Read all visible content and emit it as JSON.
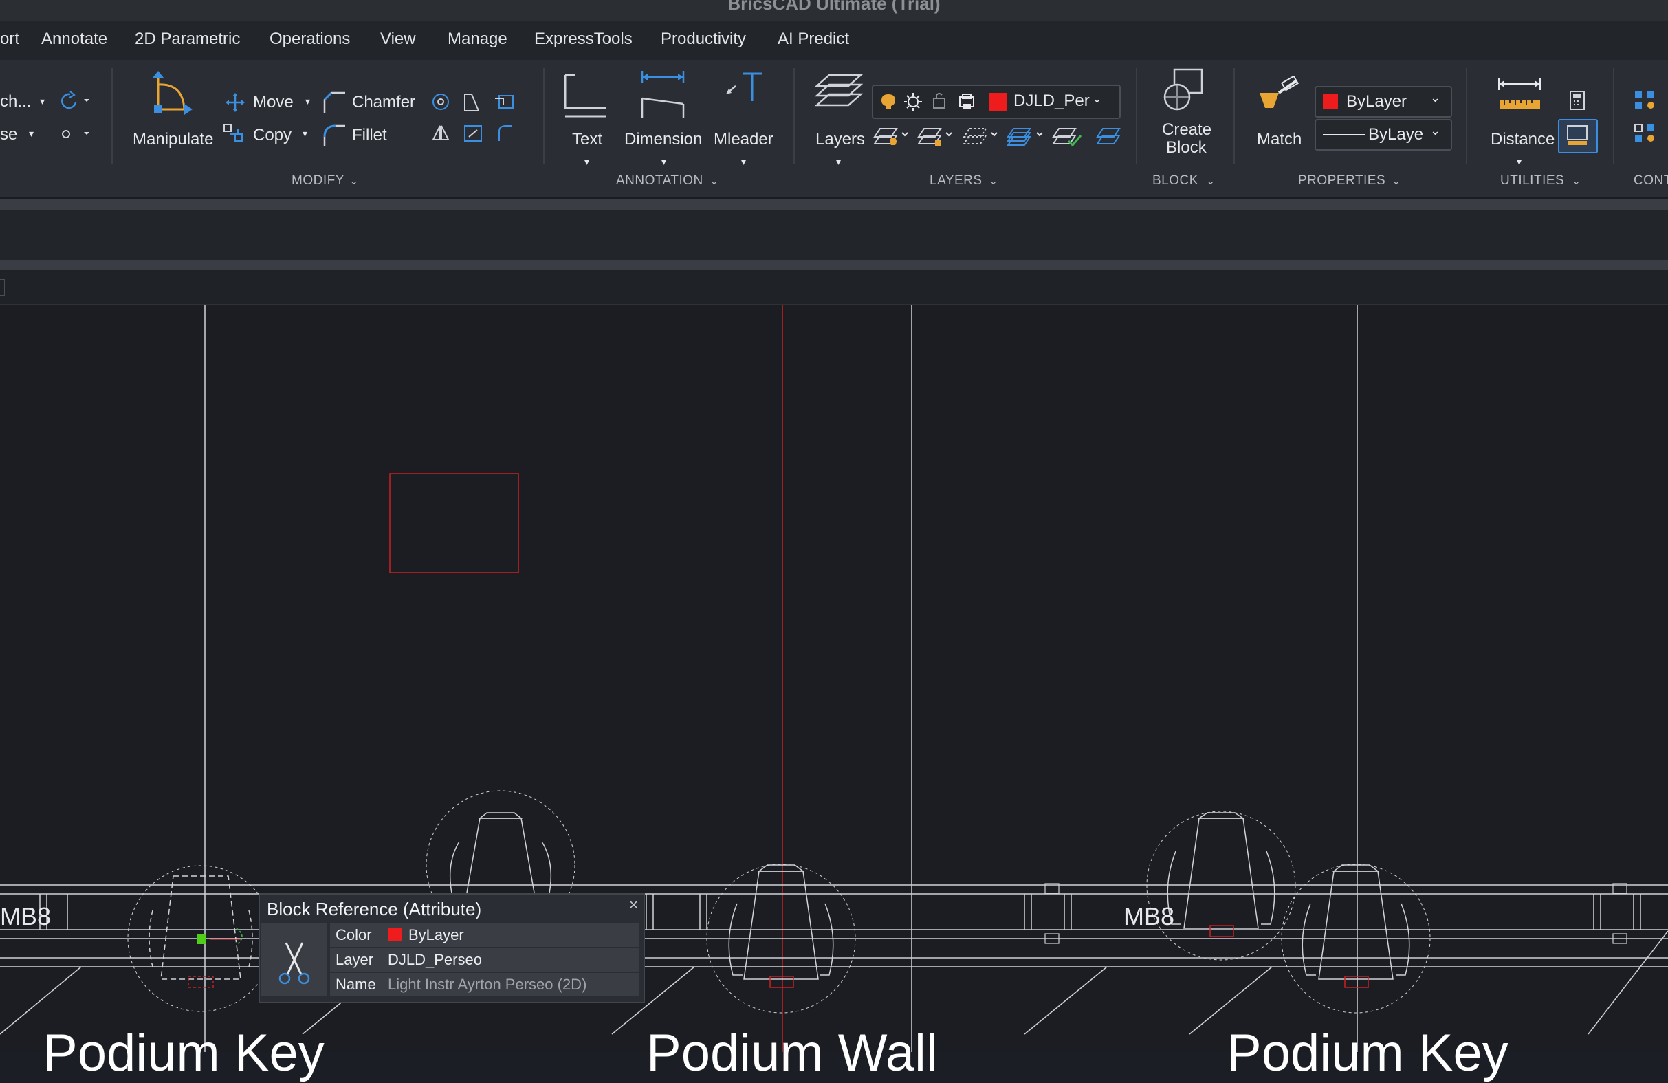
{
  "app": {
    "title": "BricsCAD Ultimate (Trial)"
  },
  "menu": [
    "ort",
    "Annotate",
    "2D Parametric",
    "Operations",
    "View",
    "Manage",
    "ExpressTools",
    "Productivity",
    "AI Predict"
  ],
  "ribbon": {
    "left_cut_1": "ch...",
    "left_cut_2": "se",
    "modify": {
      "manipulate": "Manipulate",
      "move": "Move",
      "copy": "Copy",
      "chamfer": "Chamfer",
      "fillet": "Fillet",
      "panel_label": "MODIFY"
    },
    "annotation": {
      "text": "Text",
      "dimension": "Dimension",
      "mleader": "Mleader",
      "panel_label": "ANNOTATION"
    },
    "layers": {
      "layers": "Layers",
      "current_layer": "DJLD_Per",
      "panel_label": "LAYERS"
    },
    "block": {
      "create_line1": "Create",
      "create_line2": "Block",
      "panel_label": "BLOCK"
    },
    "properties": {
      "match": "Match",
      "color": "ByLayer",
      "linetype": "ByLaye",
      "panel_label": "PROPERTIES"
    },
    "utilities": {
      "distance": "Distance",
      "panel_label": "UTILITIES"
    },
    "cont_label": "CONT"
  },
  "drawing": {
    "label_mb8_left": "MB8",
    "label_mb8_right": "MB8",
    "bottom_text_1": "Podium Key",
    "bottom_text_2": "Podium Wall",
    "bottom_text_3": "Podium Key"
  },
  "tooltip": {
    "title": "Block Reference (Attribute)",
    "close": "×",
    "color_key": "Color",
    "color_val": "ByLayer",
    "layer_key": "Layer",
    "layer_val": "DJLD_Perseo",
    "name_key": "Name",
    "name_val": "Light Instr Ayrton Perseo (2D)"
  },
  "colors": {
    "accent": "#3b8fe0",
    "layer_red": "#ee1c1c",
    "warm": "#e8a534",
    "ucs_green": "#4fcf1a"
  }
}
